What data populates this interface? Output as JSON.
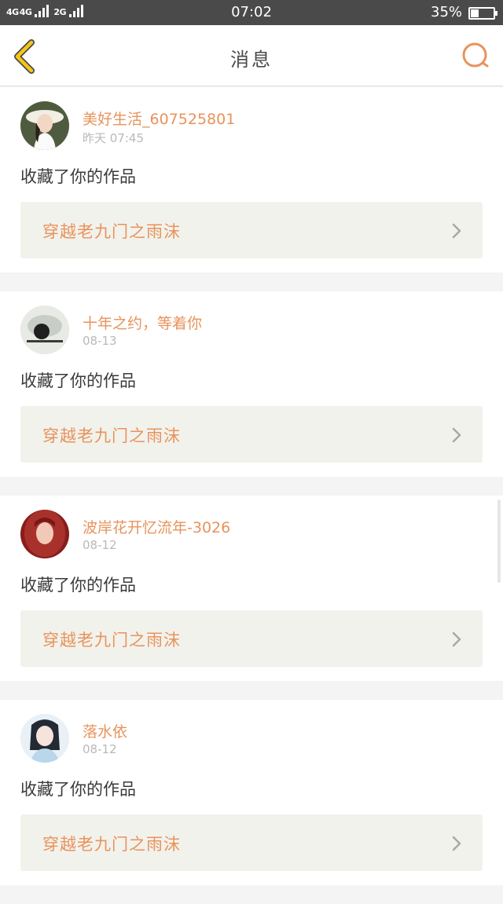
{
  "status_bar": {
    "network_1": "4G",
    "network_2": "4G",
    "network_3": "2G",
    "time": "07:02",
    "battery_percent": "35%",
    "battery_level": 0.35
  },
  "header": {
    "title": "消息",
    "back_icon": "chevron-left-icon",
    "search_icon": "search-icon"
  },
  "colors": {
    "accent": "#e8935c",
    "back_icon": "#f5c518",
    "work_link_bg": "#f2f2ec",
    "status_bar_bg": "#4a4a4a"
  },
  "messages": [
    {
      "username": "美好生活_607525801",
      "time": "昨天 07:45",
      "action": "收藏了你的作品",
      "work_title": "穿越老九门之雨沫",
      "chevron_icon": "chevron-right-icon"
    },
    {
      "username": "十年之约，等着你",
      "time": "08-13",
      "action": "收藏了你的作品",
      "work_title": "穿越老九门之雨沫",
      "chevron_icon": "chevron-right-icon"
    },
    {
      "username": "波岸花开忆流年-3026",
      "time": "08-12",
      "action": "收藏了你的作品",
      "work_title": "穿越老九门之雨沫",
      "chevron_icon": "chevron-right-icon"
    },
    {
      "username": "落水依",
      "time": "08-12",
      "action": "收藏了你的作品",
      "work_title": "穿越老九门之雨沫",
      "chevron_icon": "chevron-right-icon"
    }
  ]
}
